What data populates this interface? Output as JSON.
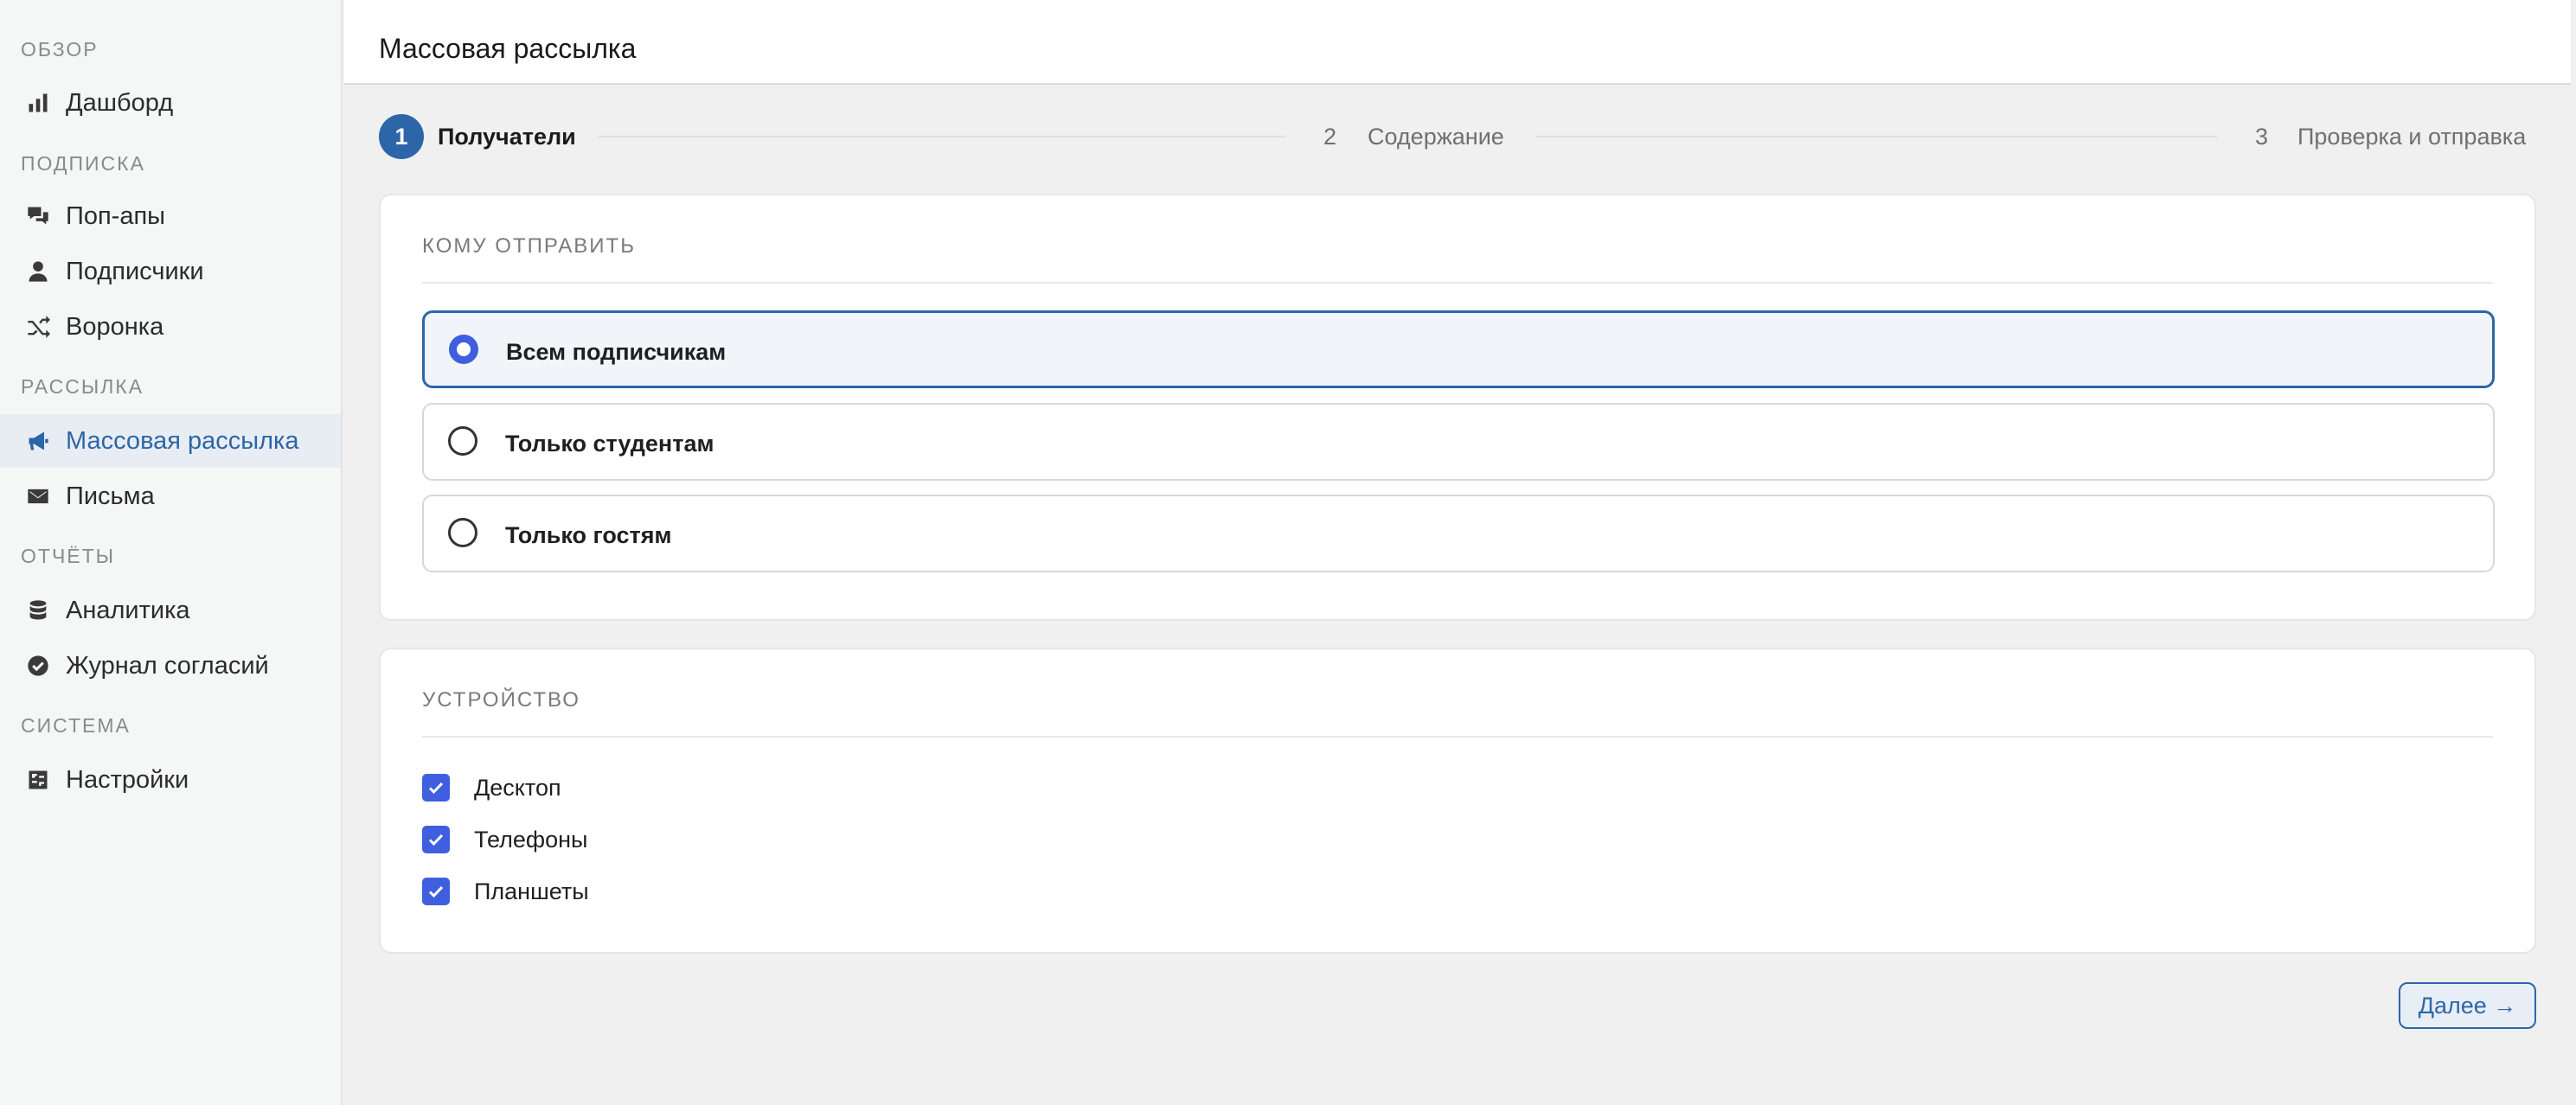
{
  "sidebar": {
    "sections": [
      {
        "label": "ОБЗОР",
        "items": [
          {
            "label": "Дашборд",
            "icon": "bar-chart-icon"
          }
        ]
      },
      {
        "label": "ПОДПИСКА",
        "items": [
          {
            "label": "Поп-апы",
            "icon": "chat-bubbles-icon"
          },
          {
            "label": "Подписчики",
            "icon": "user-icon"
          },
          {
            "label": "Воронка",
            "icon": "shuffle-icon"
          }
        ]
      },
      {
        "label": "РАССЫЛКА",
        "items": [
          {
            "label": "Массовая рассылка",
            "icon": "megaphone-icon",
            "active": true
          },
          {
            "label": "Письма",
            "icon": "envelope-icon"
          }
        ]
      },
      {
        "label": "ОТЧЁТЫ",
        "items": [
          {
            "label": "Аналитика",
            "icon": "database-icon"
          },
          {
            "label": "Журнал согласий",
            "icon": "check-circle-icon"
          }
        ]
      },
      {
        "label": "СИСТЕМА",
        "items": [
          {
            "label": "Настройки",
            "icon": "sliders-icon"
          }
        ]
      }
    ]
  },
  "header": {
    "title": "Массовая рассылка"
  },
  "stepper": {
    "steps": [
      {
        "number": "1",
        "label": "Получатели",
        "active": true
      },
      {
        "number": "2",
        "label": "Содержание",
        "active": false
      },
      {
        "number": "3",
        "label": "Проверка и отправка",
        "active": false
      }
    ]
  },
  "recipients": {
    "title": "КОМУ ОТПРАВИТЬ",
    "options": [
      {
        "label": "Всем подписчикам",
        "selected": true
      },
      {
        "label": "Только студентам",
        "selected": false
      },
      {
        "label": "Только гостям",
        "selected": false
      }
    ]
  },
  "device": {
    "title": "УСТРОЙСТВО",
    "options": [
      {
        "label": "Десктоп",
        "checked": true
      },
      {
        "label": "Телефоны",
        "checked": true
      },
      {
        "label": "Планшеты",
        "checked": true
      }
    ]
  },
  "actions": {
    "next_label": "Далее →"
  },
  "colors": {
    "accent": "#2d66a8",
    "checkbox": "#3f5fe0"
  }
}
